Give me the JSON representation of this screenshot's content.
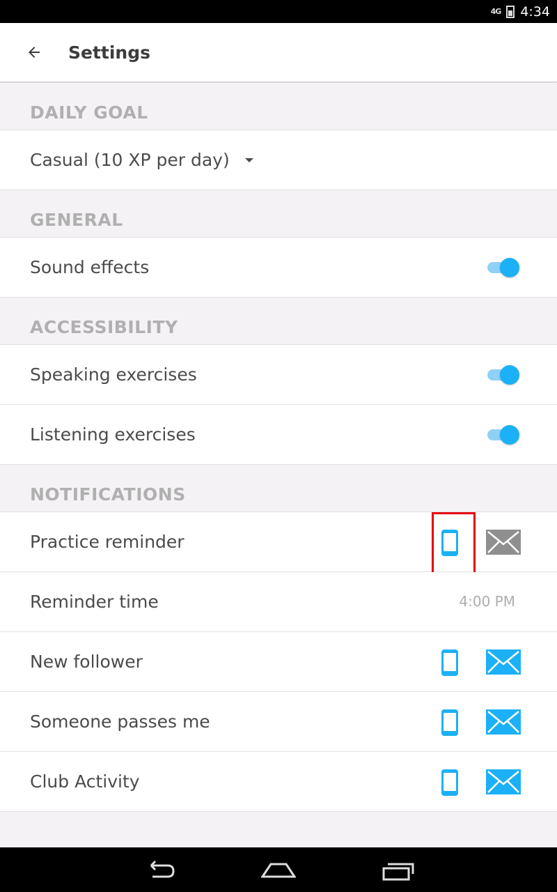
{
  "status_bar": {
    "network": "4G",
    "time": "4:34"
  },
  "app_bar": {
    "title": "Settings",
    "back_icon": "arrow-left-icon"
  },
  "sections": {
    "daily_goal": {
      "header": "DAILY GOAL",
      "value": "Casual (10 XP per day)"
    },
    "general": {
      "header": "GENERAL",
      "sound_effects": "Sound effects",
      "sound_effects_on": true
    },
    "accessibility": {
      "header": "ACCESSIBILITY",
      "speaking": "Speaking exercises",
      "speaking_on": true,
      "listening": "Listening exercises",
      "listening_on": true
    },
    "notifications": {
      "header": "NOTIFICATIONS",
      "practice_reminder": "Practice reminder",
      "reminder_time_label": "Reminder time",
      "reminder_time_value": "4:00 PM",
      "new_follower": "New follower",
      "someone_passes": "Someone passes me",
      "club_activity": "Club Activity"
    }
  },
  "colors": {
    "accent": "#1cb0f6",
    "disabled": "#8f8f8f",
    "highlight": "#e3000f"
  }
}
